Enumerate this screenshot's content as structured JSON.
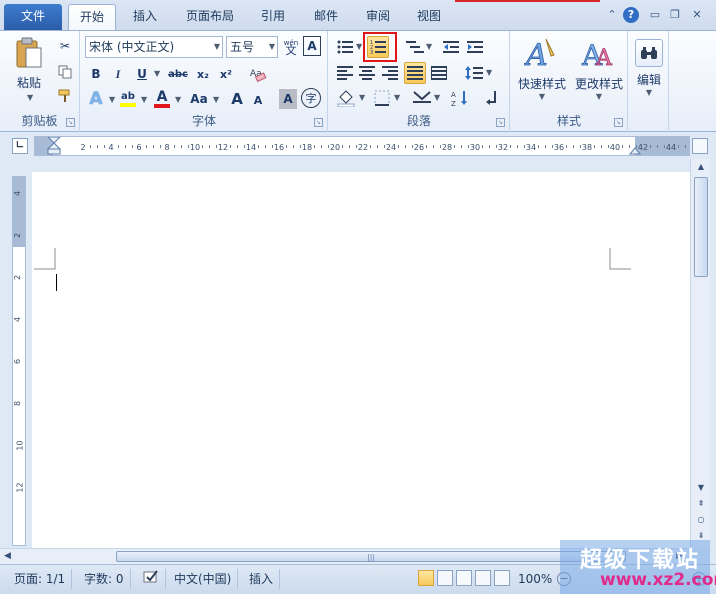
{
  "tabs": {
    "file": "文件",
    "items": [
      {
        "label": "开始",
        "active": true
      },
      {
        "label": "插入",
        "active": false
      },
      {
        "label": "页面布局",
        "active": false
      },
      {
        "label": "引用",
        "active": false
      },
      {
        "label": "邮件",
        "active": false
      },
      {
        "label": "审阅",
        "active": false
      },
      {
        "label": "视图",
        "active": false
      }
    ],
    "help_glyph": "?"
  },
  "ribbon": {
    "clipboard": {
      "label": "剪贴板",
      "paste_label": "粘贴"
    },
    "font": {
      "label": "字体",
      "font_name": "宋体 (中文正文)",
      "font_size": "五号",
      "wen": "wén",
      "bold": "B",
      "italic": "I",
      "underline": "U",
      "strike": "abc",
      "sub": "x₂",
      "sup": "x²",
      "grow": "A",
      "shrink": "A",
      "case": "Aa",
      "char_shading": "A",
      "enclose": "字"
    },
    "paragraph": {
      "label": "段落",
      "numbering_highlighted": true
    },
    "styles": {
      "label": "样式",
      "quick_styles": "快速样式",
      "change_styles": "更改样式"
    },
    "editing": {
      "label": "编辑"
    }
  },
  "ruler": {
    "ticks": [
      "2",
      "4",
      "6",
      "8",
      "10",
      "12",
      "14",
      "16",
      "18",
      "20",
      "22",
      "24",
      "26",
      "28",
      "30",
      "32",
      "34",
      "36",
      "38",
      "40",
      "42",
      "44"
    ],
    "vticks": [
      "4",
      "2",
      "2",
      "4",
      "6",
      "8",
      "10",
      "12"
    ]
  },
  "status": {
    "page": "页面: 1/1",
    "words": "字数: 0",
    "language": "中文(中国)",
    "insert": "插入",
    "zoom": "100%"
  },
  "watermark": {
    "title": "超级下载站",
    "url": "www.xz2.com"
  },
  "colors": {
    "accent": "#2a5da8",
    "highlight": "#f7c95b",
    "red_box": "#e0161b"
  }
}
